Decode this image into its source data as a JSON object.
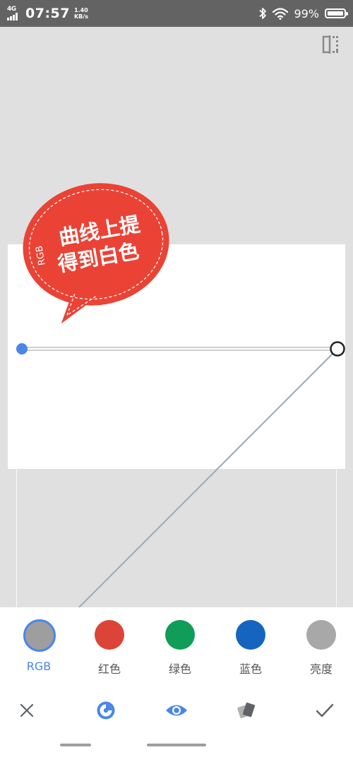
{
  "status_bar": {
    "network": "4G",
    "time": "07:57",
    "speed_value": "1.40",
    "speed_unit": "KB/s",
    "battery": "99%"
  },
  "sticker": {
    "prefix": "RGB",
    "line1": "曲线上提",
    "line2": "得到白色",
    "color": "#ea4335"
  },
  "channels": [
    {
      "label": "RGB",
      "color": "#9e9e9e",
      "selected": true
    },
    {
      "label": "红色",
      "color": "#db4437",
      "selected": false
    },
    {
      "label": "绿色",
      "color": "#0f9d58",
      "selected": false
    },
    {
      "label": "蓝色",
      "color": "#1565c0",
      "selected": false
    },
    {
      "label": "亮度",
      "color": "#a8a8a8",
      "selected": false
    }
  ],
  "toolbar": {
    "icons": [
      "close-icon",
      "curves-preset-icon",
      "eye-icon",
      "styles-icon",
      "check-icon"
    ]
  },
  "colors": {
    "accent": "#4a86e8",
    "curve_line": "#9eaeb8"
  }
}
